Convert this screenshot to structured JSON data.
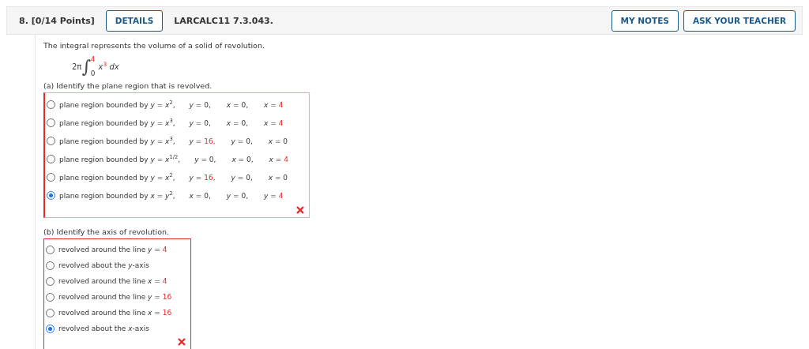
{
  "header": {
    "number": "8.",
    "points": "[0/14 Points]",
    "details": "DETAILS",
    "code": "LARCALC11 7.3.043.",
    "buttons": [
      "MY NOTES",
      "ASK YOUR TEACHER"
    ]
  },
  "prompt": "The integral represents the volume of a solid of revolution.",
  "integral": {
    "coefficient": "2π",
    "sign": "∫",
    "upper": "4",
    "lower": "0",
    "integrand": "x",
    "power": "3",
    "differential": "dx"
  },
  "parts": [
    {
      "question": "(a) Identify the plane region that is revolved.",
      "correct": false,
      "options": [
        {
          "selected": false,
          "terms": [
            {
              "lhs": "plane region bounded by *y* = *x*$^{2}$,"
            },
            {
              "lhs": "*y* =",
              "value": "0,",
              "red": false
            },
            {
              "lhs": "*x* =",
              "value": "0,",
              "red": false
            },
            {
              "lhs": "*x* =",
              "value": "4",
              "red": true
            }
          ]
        },
        {
          "selected": false,
          "terms": [
            {
              "lhs": "plane region bounded by *y* = *x*$^{3}$,"
            },
            {
              "lhs": "*y* =",
              "value": "0,",
              "red": false
            },
            {
              "lhs": "*x* =",
              "value": "0,",
              "red": false
            },
            {
              "lhs": "*x* =",
              "value": "4",
              "red": true
            }
          ]
        },
        {
          "selected": false,
          "terms": [
            {
              "lhs": "plane region bounded by *y* = *x*$^{3}$,"
            },
            {
              "lhs": "*y* =",
              "value": "16,",
              "red": true
            },
            {
              "lhs": "*y* =",
              "value": "0,",
              "red": false
            },
            {
              "lhs": "*x* =",
              "value": "0",
              "red": false
            }
          ]
        },
        {
          "selected": false,
          "terms": [
            {
              "lhs": "plane region bounded by *y* = *x*$^{1/2}$,"
            },
            {
              "lhs": "*y* =",
              "value": "0,",
              "red": false
            },
            {
              "lhs": "*x* =",
              "value": "0,",
              "red": false
            },
            {
              "lhs": "*x* =",
              "value": "4",
              "red": true
            }
          ]
        },
        {
          "selected": false,
          "terms": [
            {
              "lhs": "plane region bounded by *y* = *x*$^{2}$,"
            },
            {
              "lhs": "*y* =",
              "value": "16,",
              "red": true
            },
            {
              "lhs": "*y* =",
              "value": "0,",
              "red": false
            },
            {
              "lhs": "*x* =",
              "value": "0",
              "red": false
            }
          ]
        },
        {
          "selected": true,
          "terms": [
            {
              "lhs": "plane region bounded by *x* = *y*$^{2}$,"
            },
            {
              "lhs": "*x* =",
              "value": "0,",
              "red": false
            },
            {
              "lhs": "*y* =",
              "value": "0,",
              "red": false
            },
            {
              "lhs": "*y* =",
              "value": "4",
              "red": true
            }
          ]
        }
      ]
    },
    {
      "question": "(b) Identify the axis of revolution.",
      "correct": false,
      "options": [
        {
          "selected": false,
          "terms": [
            {
              "lhs": "revolved around the line *y* =",
              "value": "4",
              "red": true
            }
          ]
        },
        {
          "selected": false,
          "terms": [
            {
              "lhs": "revolved about the *y*-axis"
            }
          ]
        },
        {
          "selected": false,
          "terms": [
            {
              "lhs": "revolved around the line *x* =",
              "value": "4",
              "red": true
            }
          ]
        },
        {
          "selected": false,
          "terms": [
            {
              "lhs": "revolved around the line *y* =",
              "value": "16",
              "red": true
            }
          ]
        },
        {
          "selected": false,
          "terms": [
            {
              "lhs": "revolved around the line *x* =",
              "value": "16",
              "red": true
            }
          ]
        },
        {
          "selected": true,
          "terms": [
            {
              "lhs": "revolved about the *x*-axis"
            }
          ]
        }
      ]
    }
  ]
}
